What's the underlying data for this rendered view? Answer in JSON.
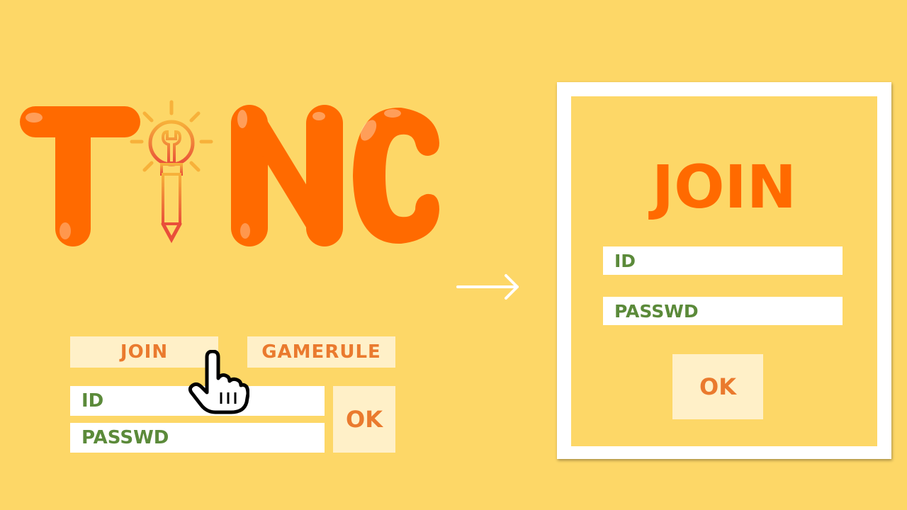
{
  "logo": {
    "letter_1": "T",
    "letter_3": "N",
    "letter_4": "C"
  },
  "main": {
    "join_label": "JOIN",
    "gamerule_label": "GAMERULE",
    "id_label": "ID",
    "passwd_label": "PASSWD",
    "ok_label": "OK"
  },
  "dialog": {
    "title": "JOIN",
    "id_label": "ID",
    "passwd_label": "PASSWD",
    "ok_label": "OK"
  },
  "icons": {
    "logo_i": "lightbulb-pencil-icon",
    "cursor": "hand-pointer-icon",
    "arrow": "arrow-right-icon"
  },
  "colors": {
    "background": "#FDD767",
    "logo_orange": "#FF6A00",
    "button_bg": "#FFF0C8",
    "button_text": "#EA7A2E",
    "field_text": "#5B8A3A"
  }
}
